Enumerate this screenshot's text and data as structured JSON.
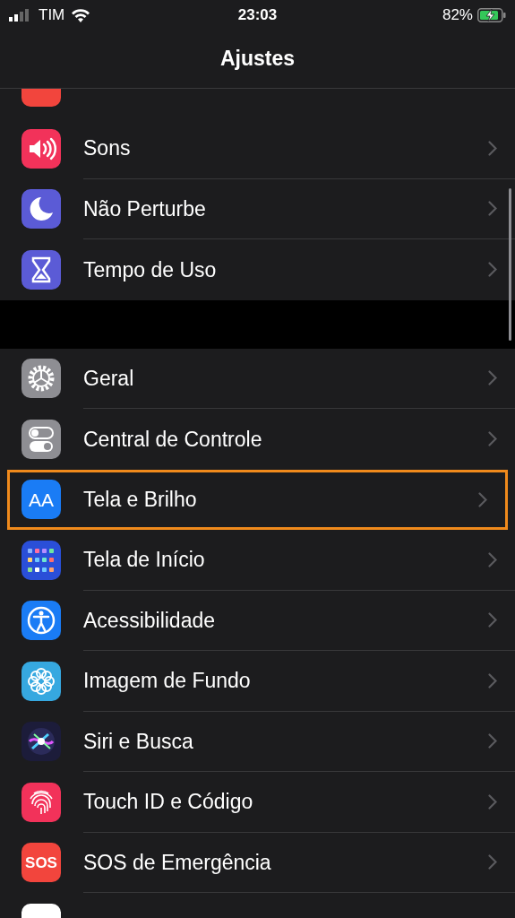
{
  "status_bar": {
    "carrier": "TIM",
    "time": "23:03",
    "battery": "82%"
  },
  "title": "Ajustes",
  "sections": [
    {
      "rows": [
        {
          "label": "Sons",
          "color": "#f2325a",
          "highlighted": false
        },
        {
          "label": "Não Perturbe",
          "color": "#5b5bd6",
          "highlighted": false
        },
        {
          "label": "Tempo de Uso",
          "color": "#5b5bd6",
          "highlighted": false
        }
      ]
    },
    {
      "rows": [
        {
          "label": "Geral",
          "color": "#8e8e93",
          "highlighted": false
        },
        {
          "label": "Central de Controle",
          "color": "#8e8e93",
          "highlighted": false
        },
        {
          "label": "Tela e Brilho",
          "icon_text": "AA",
          "color": "#1a7cf5",
          "highlighted": true
        },
        {
          "label": "Tela de Início",
          "color": "#2a4fd8",
          "highlighted": false
        },
        {
          "label": "Acessibilidade",
          "color": "#1a7cf5",
          "highlighted": false
        },
        {
          "label": "Imagem de Fundo",
          "color": "#36a8e0",
          "highlighted": false
        },
        {
          "label": "Siri e Busca",
          "color": "#1c1c3a",
          "highlighted": false
        },
        {
          "label": "Touch ID e Código",
          "color": "#f2325a",
          "highlighted": false
        },
        {
          "label": "SOS de Emergência",
          "icon_text": "SOS",
          "color": "#f2453d",
          "highlighted": false
        }
      ]
    }
  ]
}
